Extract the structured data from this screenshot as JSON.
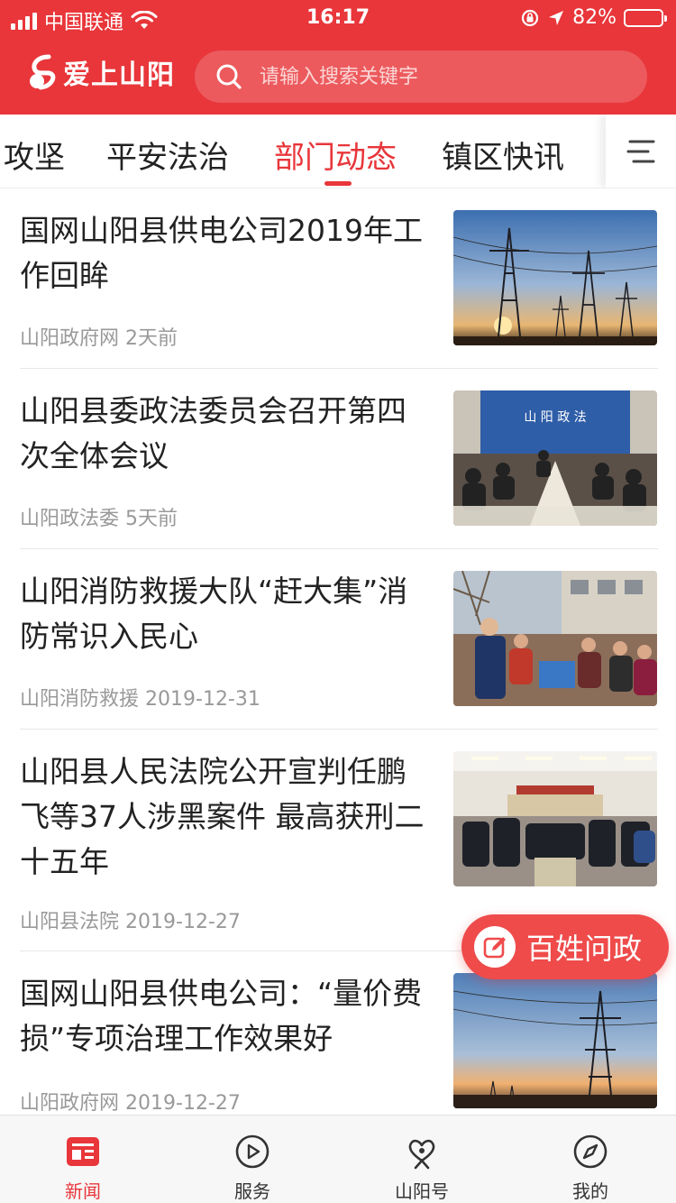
{
  "status_bar": {
    "carrier": "中国联通",
    "time": "16:17",
    "battery_text": "82%",
    "battery_level": 0.82
  },
  "header": {
    "app_name": "爱上山阳",
    "search_placeholder": "请输入搜索关键字"
  },
  "tabs": [
    {
      "label": "攻坚"
    },
    {
      "label": "平安法治"
    },
    {
      "label": "部门动态",
      "active": true
    },
    {
      "label": "镇区快讯"
    }
  ],
  "news": [
    {
      "title": "国网山阳县供电公司2019年工作回眸",
      "source": "山阳政府网",
      "time": "2天前",
      "thumb": "power-towers-sunset"
    },
    {
      "title": "山阳县委政法委员会召开第四次全体会议",
      "source": "山阳政法委",
      "time": "5天前",
      "thumb": "meeting-room",
      "thumb_text": "山 阳 政 法"
    },
    {
      "title": "山阳消防救援大队“赶大集”消防常识入民心",
      "source": "山阳消防救援",
      "time": "2019-12-31",
      "thumb": "street-market"
    },
    {
      "title": "山阳县人民法院公开宣判任鹏飞等37人涉黑案件 最高获刑二十五年",
      "source": "山阳县法院",
      "time": "2019-12-27",
      "thumb": "courtroom"
    },
    {
      "title": "国网山阳县供电公司：“量价费损”专项治理工作效果好",
      "source": "山阳政府网",
      "time": "2019-12-27",
      "thumb": "power-tower-dusk"
    }
  ],
  "fab": {
    "label": "百姓问政",
    "icon": "edit-icon"
  },
  "tabbar": [
    {
      "label": "新闻",
      "icon": "news-icon",
      "active": true
    },
    {
      "label": "服务",
      "icon": "play-icon"
    },
    {
      "label": "山阳号",
      "icon": "heart-person-icon"
    },
    {
      "label": "我的",
      "icon": "compass-icon"
    }
  ],
  "colors": {
    "brand_red": "#e8363a",
    "meta_gray": "#999999",
    "fab_red": "#ef4b4b"
  }
}
